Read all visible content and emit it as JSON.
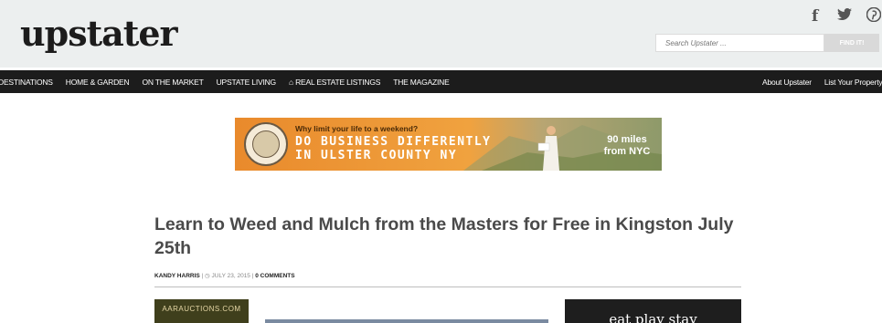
{
  "header": {
    "logo": "upstater",
    "social": {
      "facebook": "f",
      "twitter": "🐦",
      "pinterest": "℗"
    },
    "search": {
      "placeholder": "Search Upstater ...",
      "button": "FIND IT!"
    }
  },
  "nav": {
    "left_items": [
      "DESTINATIONS",
      "HOME & GARDEN",
      "ON THE MARKET",
      "UPSTATE LIVING",
      "⌂ REAL ESTATE LISTINGS",
      "THE MAGAZINE"
    ],
    "right_items": [
      "About Upstater",
      "List Your Property"
    ]
  },
  "banner": {
    "tagline": "Why limit your life to a weekend?",
    "headline_1": "DO BUSINESS DIFFERENTLY",
    "headline_2": "IN ULSTER COUNTY NY",
    "miles_1": "90 miles",
    "miles_2": "from NYC"
  },
  "article": {
    "title": "Learn to Weed and Mulch from the Masters for Free in Kingston July 25th",
    "author": "KANDY HARRIS",
    "date": "JULY 23, 2015",
    "comments": "0 COMMENTS"
  },
  "ads": {
    "left": "AARAUCTIONS.COM",
    "right": "eat play stay"
  },
  "colors": {
    "header_bg": "#ecefef",
    "nav_bg": "#1c1c1c",
    "banner_orange": "#e98a2c"
  }
}
